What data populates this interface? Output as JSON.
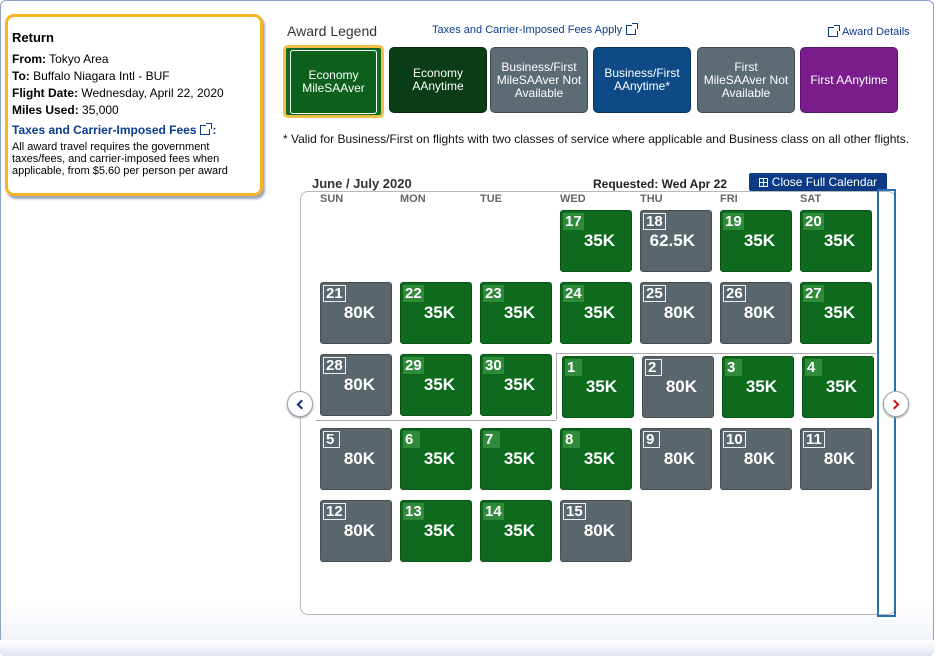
{
  "return_box": {
    "title": "Return",
    "from_label": "From:",
    "from_value": "Tokyo Area",
    "to_label": "To:",
    "to_value": "Buffalo Niagara Intl - BUF",
    "date_label": "Flight Date:",
    "date_value": "Wednesday, April 22, 2020",
    "miles_label": "Miles Used:",
    "miles_value": "35,000",
    "taxes_link": "Taxes and Carrier-Imposed Fees",
    "taxes_colon": ":",
    "disclaimer": "All award travel requires the government taxes/fees, and carrier-imposed fees when applicable, from $5.60 per person per award"
  },
  "legend": {
    "title": "Award Legend",
    "taxes_apply_link": "Taxes and Carrier-Imposed Fees Apply",
    "award_details_link": "Award Details",
    "items": [
      {
        "label": "Economy MileSAAver",
        "style": "green",
        "selected": true
      },
      {
        "label": "Economy AAnytime",
        "style": "dgreen"
      },
      {
        "label": "Business/First MileSAAver Not Available",
        "style": "gray"
      },
      {
        "label": "Business/First AAnytime*",
        "style": "blue"
      },
      {
        "label": "First MileSAAver Not Available",
        "style": "gray"
      },
      {
        "label": "First AAnytime",
        "style": "purple"
      }
    ],
    "footnote": "* Valid for Business/First on flights with two classes of service where applicable and Business class on all other flights."
  },
  "calendar": {
    "title": "June / July 2020",
    "requested": "Requested: Wed Apr 22",
    "close_button": "Close Full Calendar",
    "weekdays": [
      "SUN",
      "MON",
      "TUE",
      "WED",
      "THU",
      "FRI",
      "SAT"
    ],
    "days": [
      {
        "day": "17",
        "miles": "35K",
        "status": "green"
      },
      {
        "day": "18",
        "miles": "62.5K",
        "status": "gray"
      },
      {
        "day": "19",
        "miles": "35K",
        "status": "green"
      },
      {
        "day": "20",
        "miles": "35K",
        "status": "green"
      },
      {
        "day": "21",
        "miles": "80K",
        "status": "gray"
      },
      {
        "day": "22",
        "miles": "35K",
        "status": "green"
      },
      {
        "day": "23",
        "miles": "35K",
        "status": "green"
      },
      {
        "day": "24",
        "miles": "35K",
        "status": "green"
      },
      {
        "day": "25",
        "miles": "80K",
        "status": "gray"
      },
      {
        "day": "26",
        "miles": "80K",
        "status": "gray"
      },
      {
        "day": "27",
        "miles": "35K",
        "status": "green"
      },
      {
        "day": "28",
        "miles": "80K",
        "status": "gray"
      },
      {
        "day": "29",
        "miles": "35K",
        "status": "green"
      },
      {
        "day": "30",
        "miles": "35K",
        "status": "green"
      },
      {
        "day": "1",
        "miles": "35K",
        "status": "green"
      },
      {
        "day": "2",
        "miles": "80K",
        "status": "gray"
      },
      {
        "day": "3",
        "miles": "35K",
        "status": "green"
      },
      {
        "day": "4",
        "miles": "35K",
        "status": "green"
      },
      {
        "day": "5",
        "miles": "80K",
        "status": "gray"
      },
      {
        "day": "6",
        "miles": "35K",
        "status": "green"
      },
      {
        "day": "7",
        "miles": "35K",
        "status": "green"
      },
      {
        "day": "8",
        "miles": "35K",
        "status": "green"
      },
      {
        "day": "9",
        "miles": "80K",
        "status": "gray"
      },
      {
        "day": "10",
        "miles": "80K",
        "status": "gray"
      },
      {
        "day": "11",
        "miles": "80K",
        "status": "gray"
      },
      {
        "day": "12",
        "miles": "80K",
        "status": "gray"
      },
      {
        "day": "13",
        "miles": "35K",
        "status": "green"
      },
      {
        "day": "14",
        "miles": "35K",
        "status": "green"
      },
      {
        "day": "15",
        "miles": "80K",
        "status": "gray"
      }
    ]
  },
  "colors": {
    "available_green": "#0e6b1e",
    "unavailable_gray": "#5a666c",
    "link_blue": "#0a3c8c",
    "highlight_orange": "#f5b524"
  }
}
